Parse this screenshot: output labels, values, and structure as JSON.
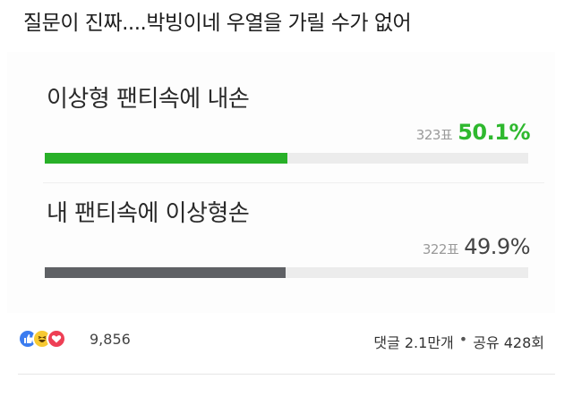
{
  "post": {
    "title": "질문이 진짜....박빙이네 우열을 가릴 수가 없어"
  },
  "poll": {
    "options": [
      {
        "label": "이상형 팬티속에 내손",
        "votes_text": "323표",
        "percent_text": "50.1%",
        "fill_fraction": 0.501,
        "bar_color": "#28b028"
      },
      {
        "label": "내 팬티속에 이상형손",
        "votes_text": "322표",
        "percent_text": "49.9%",
        "fill_fraction": 0.499,
        "bar_color": "#5f6165"
      }
    ]
  },
  "reactions": {
    "icons": [
      "like-icon",
      "haha-icon",
      "love-icon"
    ],
    "count": "9,856"
  },
  "engagement": {
    "comments": "댓글 2.1만개",
    "separator": "•",
    "shares": "공유 428회"
  }
}
